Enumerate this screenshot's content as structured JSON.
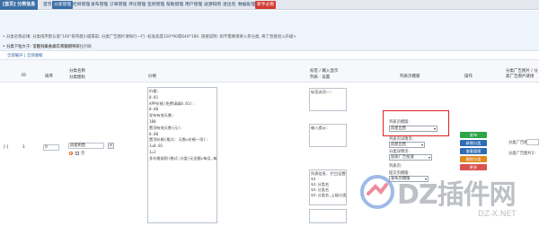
{
  "nav": {
    "brand": "[首页] 分类信息",
    "tabs": [
      "首页",
      "分类管理",
      "栏目管理",
      "发布管理",
      "订单管理",
      "评论管理",
      "签到管理",
      "帮助管理",
      "用户管理",
      "返源码购",
      "退出包",
      "数据处理",
      "新手必看"
    ],
    "active_index": 1
  },
  "tips": {
    "line1": "• 分类名称必填: 分类排序默认值\"100\"排序越小越靠前; 分类广告图片请每行一行: 标准高度320*90或640*180. 链接说明: 如不需要请将入参分类, 将了直接进入升级>",
    "line2": "• 分类下拉大于: 下拉列表分类行添加引导下拉列表",
    "line3": "• 分类下拉大于: 设置分类会员工作管理列表"
  },
  "links": "全部展开 | 全部收缩",
  "table": {
    "headers": {
      "id": "ID",
      "sort": "排序",
      "name": "分类名称",
      "name_sub": "分类图标",
      "price": "价格",
      "tags": "标签 / 输入显示",
      "tags_sub": "列表 · 设置",
      "list_tpl": "列表页模版",
      "action": "操作",
      "adpic": "分类广告图片 / 分类广告图片链接"
    },
    "row": {
      "toggle": "[-]",
      "id": "1",
      "sort": "0",
      "name_value": "房屋租售",
      "radio_label": "否",
      "price_area": "价格:\n0.01\nAPP价格(免费请填0.01):\n0.00\n发布有效天数:\n180\n置顶有效天数(元):\n0.00\n置顶价格(格式: 天数=价格一项):\n1=0.01\n1=1\n多价格规则(格式:分类(元金额=每月,每月一项, 月下钱):",
      "tags_label1": "标签选项一:",
      "tags_label2": "输入提示:",
      "list_note": "列表页模版:",
      "list_select": "房屋出售",
      "detail_note": "列表页详情页:",
      "detail_select": "房屋出售",
      "detail_sub": "分类详情页:",
      "detail_sub_select": "居家广告投放",
      "field_note1": "列表页:",
      "field_note2": "提交页模版:",
      "field_select": "发布页模版",
      "adpic_label": "分类广告图片1:",
      "adpic_label2": "分类广告图片2:",
      "textarea_bottom": "列表信息, 栏目设置信息:\n$4\n$4.分类名\n$4.分类名\n$4.分类名,上级分类名",
      "buttons": {
        "save": "发布",
        "add": "新增分类",
        "view": "查看管理",
        "delete": "删除分类",
        "edit": "更多"
      }
    }
  },
  "watermark": {
    "text": "DZ插件网",
    "sub": "DZ-X.NET"
  },
  "colors": {
    "active_tab": "#3a6ea8",
    "addon_tab": "#d33b32",
    "green": "#2fa54a",
    "blue": "#2e6db5",
    "orange": "#e08a1f",
    "red": "#d9534f"
  }
}
